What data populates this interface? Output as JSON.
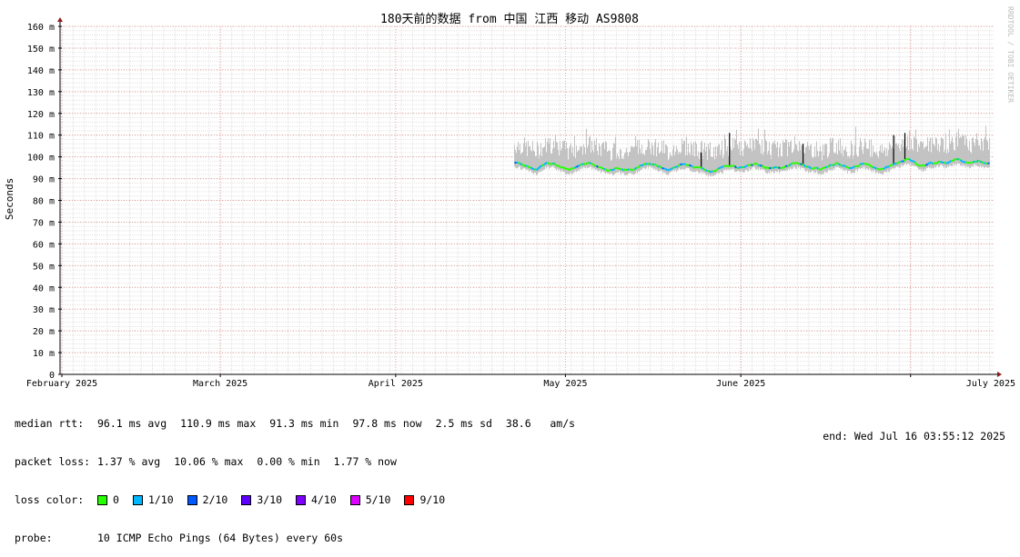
{
  "chart_data": {
    "type": "line",
    "title": "180天前的数据 from 中国 江西 移动 AS9808",
    "ylabel": "Seconds",
    "watermark": "RRDTOOL / TOBI OETIKER",
    "ylim": [
      0,
      160
    ],
    "y_ticks": [
      "0",
      "10 m",
      "20 m",
      "30 m",
      "40 m",
      "50 m",
      "60 m",
      "70 m",
      "80 m",
      "90 m",
      "100 m",
      "110 m",
      "120 m",
      "130 m",
      "140 m",
      "150 m",
      "160 m"
    ],
    "x_ticks": [
      {
        "day": 32,
        "label": "February 2025"
      },
      {
        "day": 60,
        "label": "March 2025"
      },
      {
        "day": 91,
        "label": "April 2025"
      },
      {
        "day": 121,
        "label": "May 2025"
      },
      {
        "day": 152,
        "label": "June 2025"
      },
      {
        "day": 182,
        "label": "July 2025"
      }
    ],
    "x_range_days": [
      32,
      197
    ],
    "data_start_day": 112,
    "data_end_day": 196,
    "median_ms": [
      97,
      97,
      96,
      95,
      94,
      96,
      97,
      97,
      96,
      95,
      94,
      95,
      96,
      97,
      97,
      96,
      95,
      94,
      94,
      95,
      94,
      94,
      94,
      96,
      97,
      97,
      96,
      95,
      94,
      95,
      96,
      97,
      96,
      95,
      95,
      94,
      93,
      94,
      95,
      96,
      96,
      95,
      95,
      96,
      97,
      96,
      95,
      95,
      95,
      95,
      96,
      97,
      97,
      96,
      95,
      95,
      94,
      95,
      96,
      97,
      96,
      95,
      95,
      96,
      97,
      96,
      95,
      94,
      95,
      96,
      97,
      98,
      99,
      98,
      96,
      96,
      97,
      97,
      98,
      97,
      98,
      99,
      98,
      97,
      98,
      98,
      97,
      97
    ],
    "spike_ms": [
      {
        "day": 145,
        "value": 102
      },
      {
        "day": 150,
        "value": 111
      },
      {
        "day": 163,
        "value": 106
      },
      {
        "day": 179,
        "value": 110
      },
      {
        "day": 181,
        "value": 111
      },
      {
        "day": 187,
        "value": 98
      }
    ],
    "series": [
      {
        "name": "loss 0",
        "color": "#26ff00"
      },
      {
        "name": "loss 1/10",
        "color": "#00b8ff"
      },
      {
        "name": "loss 2/10",
        "color": "#0059ff"
      },
      {
        "name": "loss 3/10",
        "color": "#5e00ff"
      },
      {
        "name": "loss 4/10",
        "color": "#7e00ff"
      },
      {
        "name": "loss 5/10",
        "color": "#dd00ff"
      },
      {
        "name": "loss 9/10",
        "color": "#ff0000"
      }
    ],
    "smoke_color": "#c0c0c0",
    "grid": true
  },
  "legend": {
    "median_rtt": {
      "label": "median rtt:",
      "stats": [
        "96.1 ms avg",
        "110.9 ms max",
        "91.3 ms min",
        "97.8 ms now",
        "2.5 ms sd",
        "38.6   am/s"
      ]
    },
    "packet_loss": {
      "label": "packet loss:",
      "stats": [
        "1.37 % avg",
        "10.06 % max",
        "0.00 % min",
        "1.77 % now"
      ]
    },
    "loss_color": {
      "label": "loss color:",
      "items": [
        {
          "label": "0",
          "color": "#26ff00"
        },
        {
          "label": "1/10",
          "color": "#00b8ff"
        },
        {
          "label": "2/10",
          "color": "#0059ff"
        },
        {
          "label": "3/10",
          "color": "#5e00ff"
        },
        {
          "label": "4/10",
          "color": "#7e00ff"
        },
        {
          "label": "5/10",
          "color": "#dd00ff"
        },
        {
          "label": "9/10",
          "color": "#ff0000"
        }
      ]
    },
    "probe": {
      "label": "probe:",
      "value": "10 ICMP Echo Pings (64 Bytes) every 60s"
    },
    "end": "end: Wed Jul 16 03:55:12 2025"
  }
}
